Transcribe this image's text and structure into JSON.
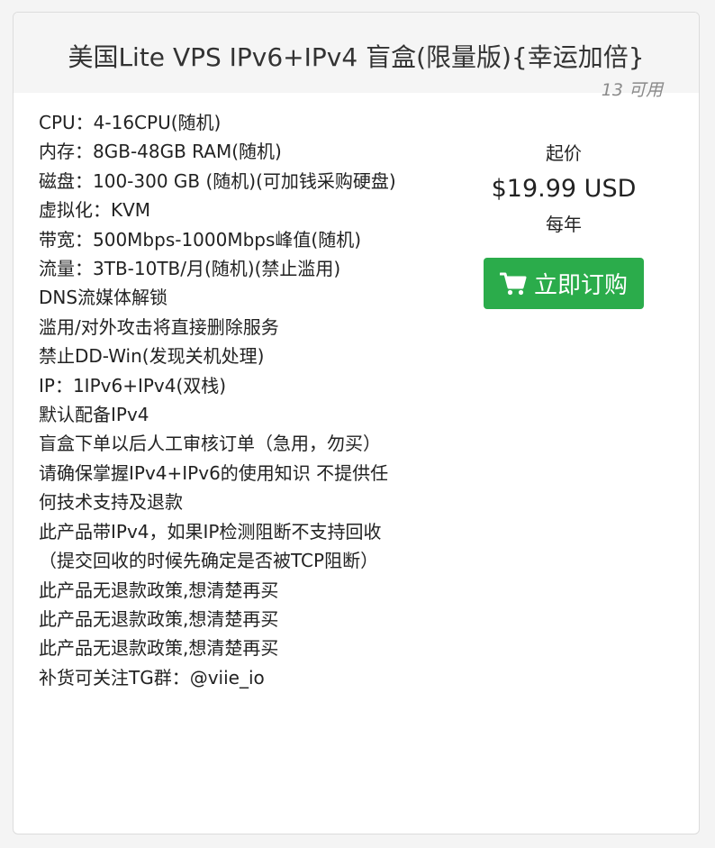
{
  "product": {
    "title": "美国Lite VPS IPv6+IPv4 盲盒(限量版){幸运加倍}",
    "availability": "13 可用",
    "features": [
      "CPU：4-16CPU(随机)",
      "内存：8GB-48GB RAM(随机)",
      "磁盘：100-300 GB (随机)(可加钱采购硬盘)",
      "虚拟化：KVM",
      "带宽：500Mbps-1000Mbps峰值(随机)",
      "流量：3TB-10TB/月(随机)(禁止滥用)",
      "DNS流媒体解锁",
      "滥用/对外攻击将直接删除服务",
      "禁止DD-Win(发现关机处理)",
      "IP：1IPv6+IPv4(双栈)",
      "默认配备IPv4",
      "盲盒下单以后人工审核订单（急用，勿买）",
      "请确保掌握IPv4+IPv6的使用知识 不提供任何技术支持及退款",
      "此产品带IPv4，如果IP检测阻断不支持回收（提交回收的时候先确定是否被TCP阻断）",
      "此产品无退款政策,想清楚再买",
      "此产品无退款政策,想清楚再买",
      "此产品无退款政策,想清楚再买",
      "补货可关注TG群：@viie_io"
    ]
  },
  "pricing": {
    "from_label": "起价",
    "amount": "$19.99 USD",
    "cycle": "每年",
    "order_button": "立即订购",
    "order_icon": "shopping-cart-icon",
    "button_color": "#2bac4b"
  }
}
